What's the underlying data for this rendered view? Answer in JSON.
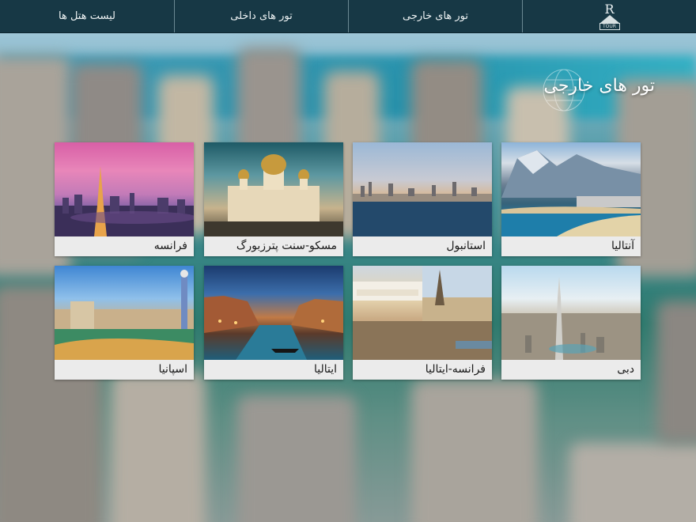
{
  "nav": {
    "logo_letter": "R",
    "logo_word": "TOUR",
    "items": [
      {
        "label": "تور های خارجی"
      },
      {
        "label": "تور های داخلی"
      },
      {
        "label": "لیست هتل ها"
      }
    ]
  },
  "section": {
    "title": "تور های خارجی"
  },
  "tours": [
    {
      "name": "فرانسه",
      "image": "paris-eiffel-tower-sunset"
    },
    {
      "name": "مسکو-سنت پترزبورگ",
      "image": "moscow-cathedral"
    },
    {
      "name": "استانبول",
      "image": "istanbul-skyline"
    },
    {
      "name": "آنتالیا",
      "image": "antalya-coast-mountains"
    },
    {
      "name": "اسپانیا",
      "image": "barcelona-park-guell"
    },
    {
      "name": "ایتالیا",
      "image": "venice-grand-canal"
    },
    {
      "name": "فرانسه-ایتالیا",
      "image": "rome-and-paris-collage"
    },
    {
      "name": "دبی",
      "image": "dubai-burj-khalifa"
    }
  ],
  "colors": {
    "nav_bg": "#173845",
    "caption_bg": "#ebebeb",
    "title_text": "#ffffff"
  }
}
